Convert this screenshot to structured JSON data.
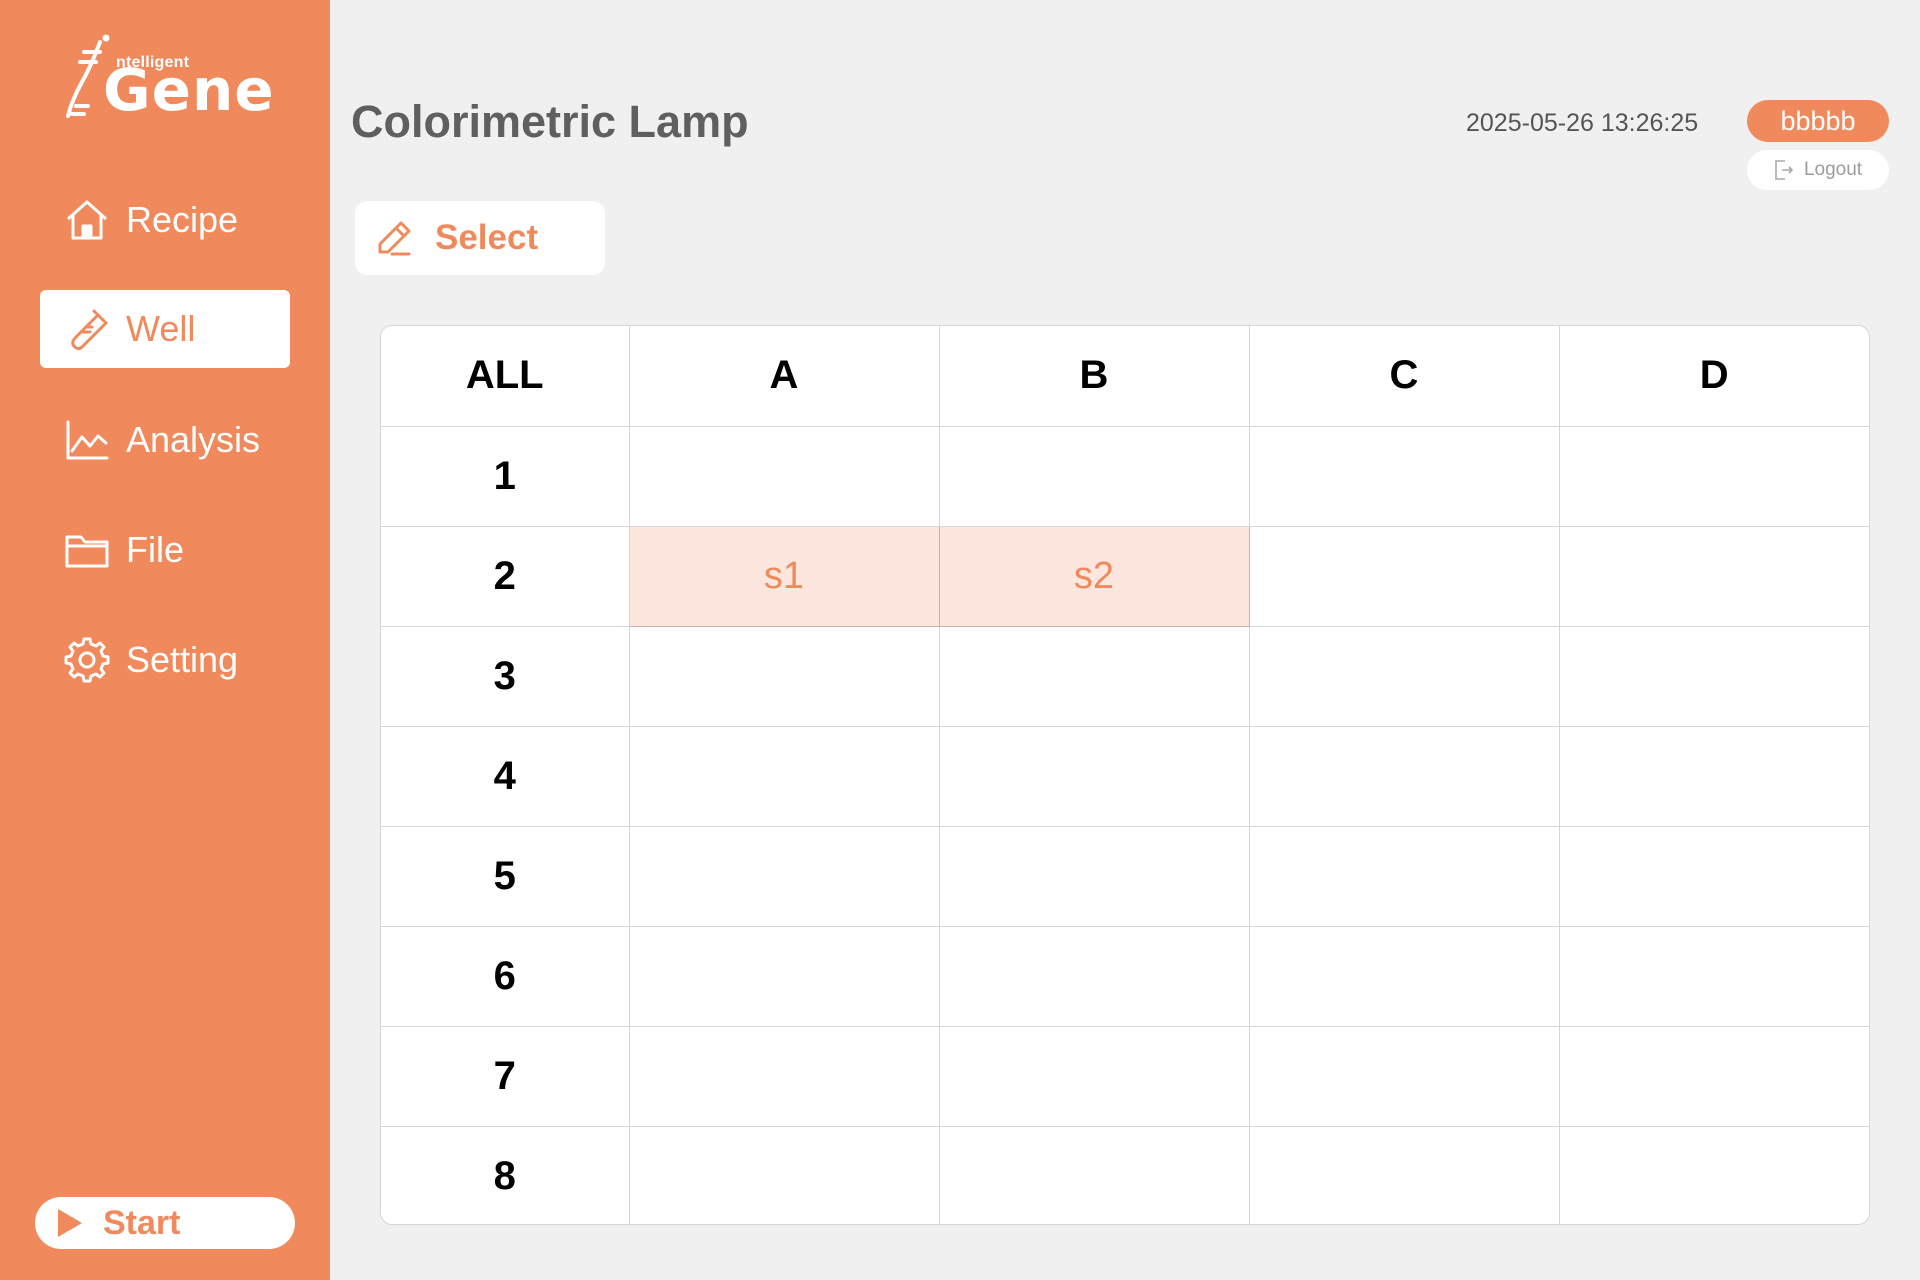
{
  "brand": {
    "logo_small": "ntelligent",
    "logo_big": "Gene",
    "color": "#f08a5d",
    "icon": "dna-icon"
  },
  "sidebar": {
    "items": [
      {
        "label": "Recipe",
        "icon": "home-icon",
        "active": false
      },
      {
        "label": "Well",
        "icon": "test-tube-icon",
        "active": true
      },
      {
        "label": "Analysis",
        "icon": "line-chart-icon",
        "active": false
      },
      {
        "label": "File",
        "icon": "folder-icon",
        "active": false
      },
      {
        "label": "Setting",
        "icon": "gear-icon",
        "active": false
      }
    ],
    "start_label": "Start"
  },
  "header": {
    "title": "Colorimetric Lamp",
    "datetime": "2025-05-26 13:26:25",
    "user": "bbbbb",
    "logout_label": "Logout"
  },
  "toolbar": {
    "select_label": "Select"
  },
  "grid": {
    "corner_label": "ALL",
    "columns": [
      "A",
      "B",
      "C",
      "D"
    ],
    "rows": [
      {
        "label": "1",
        "cells": [
          "",
          "",
          "",
          ""
        ]
      },
      {
        "label": "2",
        "cells": [
          "s1",
          "s2",
          "",
          ""
        ]
      },
      {
        "label": "3",
        "cells": [
          "",
          "",
          "",
          ""
        ]
      },
      {
        "label": "4",
        "cells": [
          "",
          "",
          "",
          ""
        ]
      },
      {
        "label": "5",
        "cells": [
          "",
          "",
          "",
          ""
        ]
      },
      {
        "label": "6",
        "cells": [
          "",
          "",
          "",
          ""
        ]
      },
      {
        "label": "7",
        "cells": [
          "",
          "",
          "",
          ""
        ]
      },
      {
        "label": "8",
        "cells": [
          "",
          "",
          "",
          ""
        ]
      }
    ],
    "filled_color": "#fce6de"
  }
}
